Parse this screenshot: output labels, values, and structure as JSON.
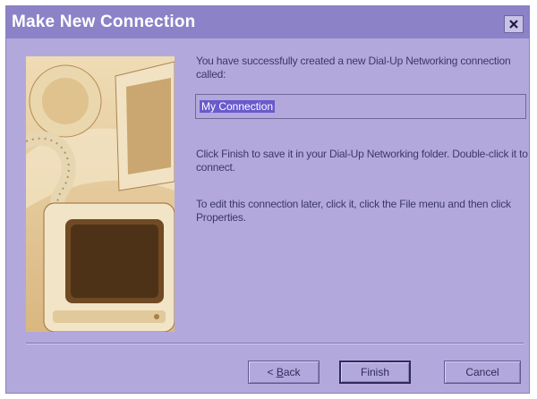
{
  "window": {
    "title": "Make New Connection"
  },
  "content": {
    "message_created": "You have successfully created a new Dial-Up Networking connection called:",
    "connection_name": "My Connection",
    "message_finish": "Click Finish to save it in your Dial-Up Networking folder. Double-click it to connect.",
    "message_edit": "To edit this connection later, click it, click the File menu and then click Properties."
  },
  "buttons": {
    "back_prefix": "< ",
    "back_mnemonic": "B",
    "back_rest": "ack",
    "finish": "Finish",
    "cancel": "Cancel"
  },
  "icons": {
    "close": "close-icon",
    "picture": "computer-monitor-illustration"
  },
  "colors": {
    "title_bar": "#8b82c8",
    "dialog_bg": "#b3a8dc",
    "selection": "#6a5acd"
  }
}
